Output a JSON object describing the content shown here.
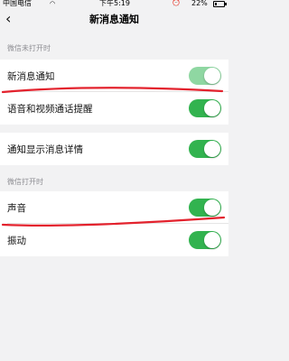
{
  "status_bar": {
    "carrier": "中国电信",
    "time": "下午5:19",
    "battery_pct": "22%",
    "battery_level": 0.22,
    "icons": [
      "wifi-icon",
      "alarm-icon",
      "battery-icon"
    ]
  },
  "nav": {
    "back_icon": "chevron-left-icon",
    "title": "新消息通知"
  },
  "sections": [
    {
      "header": "微信未打开时",
      "groups": [
        {
          "rows": [
            {
              "label": "新消息通知",
              "on": true,
              "dimmed": true
            },
            {
              "label": "语音和视频通话提醒",
              "on": true,
              "dimmed": false
            }
          ]
        },
        {
          "rows": [
            {
              "label": "通知显示消息详情",
              "on": true,
              "dimmed": false
            }
          ]
        }
      ]
    },
    {
      "header": "微信打开时",
      "groups": [
        {
          "rows": [
            {
              "label": "声音",
              "on": true,
              "dimmed": false
            },
            {
              "label": "振动",
              "on": true,
              "dimmed": false
            }
          ]
        }
      ]
    }
  ],
  "colors": {
    "toggle_on": "#32b34f",
    "toggle_dimmed": "#8fd7a2",
    "annotation": "#e3222d",
    "background": "#f2f2f3"
  }
}
